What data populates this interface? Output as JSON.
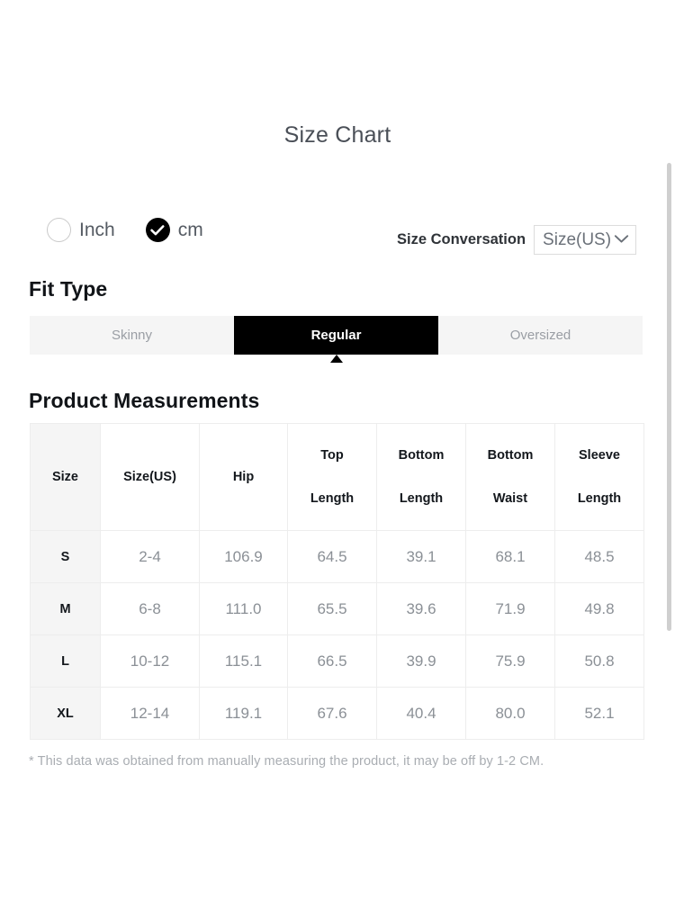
{
  "title": "Size Chart",
  "units": {
    "options": [
      {
        "label": "Inch",
        "selected": false,
        "icon": "radio-unchecked-icon"
      },
      {
        "label": "cm",
        "selected": true,
        "icon": "radio-checked-icon"
      }
    ]
  },
  "size_conversation": {
    "label": "Size Conversation",
    "selected": "Size(US)",
    "chevron": "chevron-down-icon"
  },
  "fit_type": {
    "heading": "Fit Type",
    "tabs": [
      {
        "label": "Skinny",
        "active": false
      },
      {
        "label": "Regular",
        "active": true
      },
      {
        "label": "Oversized",
        "active": false
      }
    ],
    "pointer": "triangle-up-icon"
  },
  "measurements": {
    "heading": "Product Measurements",
    "columns": [
      {
        "line1": "Size",
        "line2": ""
      },
      {
        "line1": "Size(US)",
        "line2": ""
      },
      {
        "line1": "Hip",
        "line2": ""
      },
      {
        "line1": "Top",
        "line2": "Length"
      },
      {
        "line1": "Bottom",
        "line2": "Length"
      },
      {
        "line1": "Bottom",
        "line2": "Waist"
      },
      {
        "line1": "Sleeve",
        "line2": "Length"
      }
    ],
    "rows": [
      {
        "size": "S",
        "size_us": "2-4",
        "hip": "106.9",
        "top_length": "64.5",
        "bottom_length": "39.1",
        "bottom_waist": "68.1",
        "sleeve_length": "48.5"
      },
      {
        "size": "M",
        "size_us": "6-8",
        "hip": "111.0",
        "top_length": "65.5",
        "bottom_length": "39.6",
        "bottom_waist": "71.9",
        "sleeve_length": "49.8"
      },
      {
        "size": "L",
        "size_us": "10-12",
        "hip": "115.1",
        "top_length": "66.5",
        "bottom_length": "39.9",
        "bottom_waist": "75.9",
        "sleeve_length": "50.8"
      },
      {
        "size": "XL",
        "size_us": "12-14",
        "hip": "119.1",
        "top_length": "67.6",
        "bottom_length": "40.4",
        "bottom_waist": "80.0",
        "sleeve_length": "52.1"
      }
    ]
  },
  "footnote": "* This data was obtained from manually measuring the product, it may be off by 1-2 CM.",
  "colors": {
    "accent": "#000000",
    "page_bg": "#ffffff",
    "muted_text": "#8b9096",
    "tab_bg": "#f5f5f5",
    "border": "#ededed",
    "scrollbar": "#cfcfcf"
  }
}
